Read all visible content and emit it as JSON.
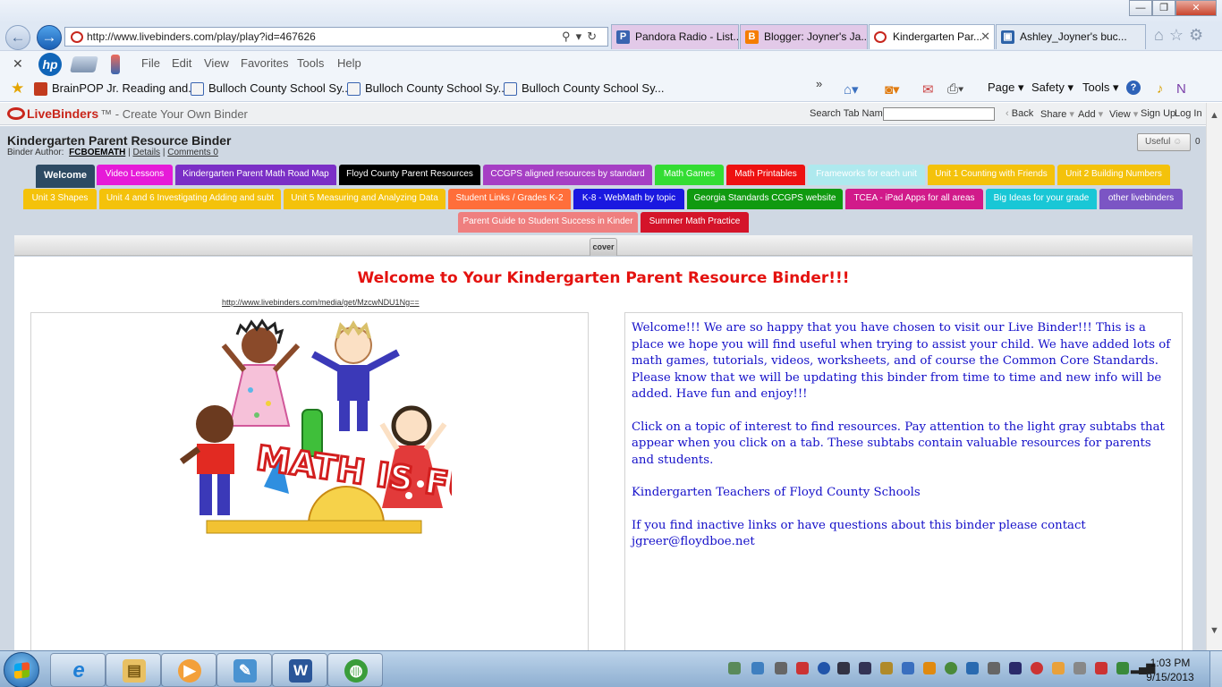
{
  "browser": {
    "window_controls": {
      "minimize": "—",
      "maximize": "❐",
      "close": "✕"
    },
    "address": {
      "url": "http://www.livebinders.com/play/play?id=467626"
    },
    "tabs": [
      {
        "label": "Pandora Radio - List...",
        "icon": "P"
      },
      {
        "label": "Blogger: Joyner's Ja...",
        "icon": "B"
      },
      {
        "label": "Kindergarten Par...",
        "close": "✕"
      },
      {
        "label": "Ashley_Joyner's buc...",
        "icon": "▣"
      }
    ],
    "menu": [
      "File",
      "Edit",
      "View",
      "Favorites",
      "Tools",
      "Help"
    ],
    "menu_close": "✕",
    "hp_label": "hp",
    "favorites": [
      "BrainPOP Jr. Reading and...",
      "Bulloch County School Sy...",
      "Bulloch County School Sy...",
      "Bulloch County School Sy..."
    ],
    "favorites_more": "»",
    "command_bar": {
      "page": "Page ▾",
      "safety": "Safety ▾",
      "tools": "Tools ▾",
      "help": "?"
    }
  },
  "livebinders": {
    "brand": "LiveBinders",
    "tagline": "™ - Create Your Own Binder",
    "search_label": "Search Tab Names",
    "search_value": "",
    "links": [
      "Back",
      "Share",
      "Add",
      "View",
      "Sign Up",
      "Log In"
    ]
  },
  "binder": {
    "title": "Kindergarten Parent Resource Binder",
    "author_label": "Binder Author:",
    "author": "FCBOEMATH",
    "details": "Details",
    "comments": "Comments 0",
    "useful_label": "Useful",
    "useful_count": "0",
    "tabs": [
      {
        "label": "Welcome",
        "color": "#2d4a63"
      },
      {
        "label": "Video Lessons",
        "color": "#e61ad8"
      },
      {
        "label": "Kindergarten Parent Math Road Map",
        "color": "#7b2fc6"
      },
      {
        "label": "Floyd County Parent Resources",
        "color": "#000000"
      },
      {
        "label": "CCGPS aligned resources by standard",
        "color": "#a63fc4"
      },
      {
        "label": "Math Games",
        "color": "#33dd33"
      },
      {
        "label": "Math Printables",
        "color": "#ee1111"
      },
      {
        "label": "Frameworks for each unit",
        "color": "#aee9ee"
      },
      {
        "label": "Unit 1 Counting with Friends",
        "color": "#f4c20b"
      },
      {
        "label": "Unit 2 Building Numbers",
        "color": "#f4c20b"
      },
      {
        "label": "Unit 3 Shapes",
        "color": "#f4c20b"
      },
      {
        "label": "Unit 4 and 6 Investigating Adding and subt",
        "color": "#f4c20b"
      },
      {
        "label": "Unit 5 Measuring and Analyzing Data",
        "color": "#f4c20b"
      },
      {
        "label": "Student Links / Grades K-2",
        "color": "#ff6e3a"
      },
      {
        "label": "K-8 - WebMath by topic",
        "color": "#1a18e0"
      },
      {
        "label": "Georgia Standards CCGPS website",
        "color": "#109a10"
      },
      {
        "label": "TCEA - iPad Apps for all areas",
        "color": "#d11a8a"
      },
      {
        "label": "Big Ideas for your grade",
        "color": "#19c7d6"
      },
      {
        "label": "other livebinders",
        "color": "#7b55c4"
      },
      {
        "label": "Parent Guide to Student Success in Kinder",
        "color": "#ef7f7f"
      },
      {
        "label": "Summer Math Practice",
        "color": "#d4142a"
      }
    ],
    "subtab": "cover"
  },
  "page": {
    "heading": "Welcome to Your Kindergarten Parent Resource Binder!!!",
    "media_link": "http://www.livebinders.com/media/get/MzcwNDU1Ng==",
    "image_text": "MATH IS FUN",
    "paragraphs": [
      "Welcome!!! We are so happy that you have chosen to visit our Live Binder!!!  This is a place we hope you will find useful when trying to assist your child.  We have added lots of math games, tutorials, videos, worksheets, and of course the Common Core Standards.  Please know that we will be updating this binder from time to time and new info will be added.  Have fun and enjoy!!!",
      "Click on a topic of interest to find resources.  Pay attention to the light gray subtabs that appear when you click on a tab.  These subtabs contain valuable resources for parents and students.",
      "Kindergarten Teachers of Floyd County Schools",
      "If you find inactive links or have questions about this binder please contact jgreer@floydboe.net"
    ]
  },
  "taskbar": {
    "apps": [
      {
        "name": "internet-explorer",
        "glyph": "e",
        "color": "#1f7fd6"
      },
      {
        "name": "file-explorer",
        "glyph": "▤",
        "color": "#d9a740"
      },
      {
        "name": "media-player",
        "glyph": "▶",
        "color": "#f08a1a"
      },
      {
        "name": "notepad",
        "glyph": "✎",
        "color": "#3a88c9"
      },
      {
        "name": "word",
        "glyph": "W",
        "color": "#2a5699"
      },
      {
        "name": "globe",
        "glyph": "◍",
        "color": "#3a9d3a"
      }
    ],
    "time": "1:03 PM",
    "date": "9/15/2013"
  }
}
